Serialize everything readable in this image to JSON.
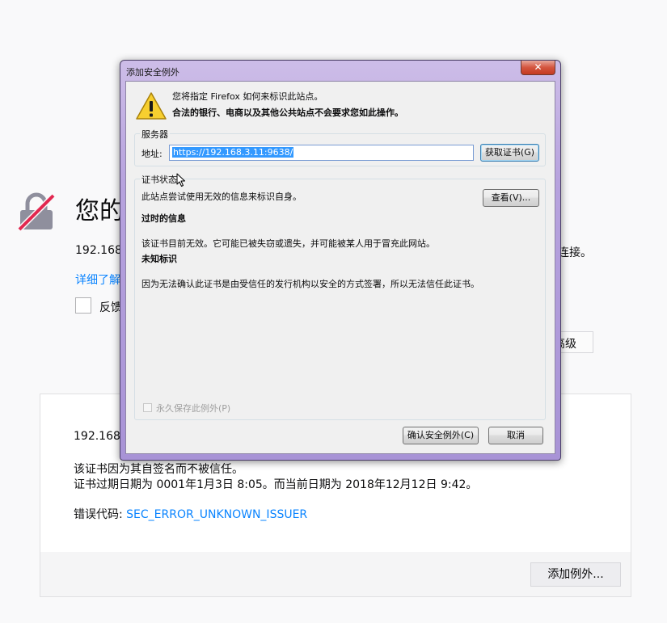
{
  "error_page": {
    "title": "您的",
    "description": "192.168.",
    "description_tail": "连接。",
    "learn_more": "详细了解",
    "report_label": "反馈",
    "advanced_button": "高级",
    "advanced_panel": {
      "host": "192.168.",
      "line1": "该证书因为其自签名而不被信任。",
      "line2": "证书过期日期为 0001年1月3日 8:05。而当前日期为 2018年12月12日 9:42。",
      "error_code_label": "错误代码: ",
      "error_code": "SEC_ERROR_UNKNOWN_ISSUER",
      "add_exception_button": "添加例外..."
    },
    "lock_icon": "lock-broken-icon"
  },
  "dialog": {
    "title": "添加安全例外",
    "close_icon": "close-icon",
    "close_glyph": "✕",
    "warning_icon": "warning-triangle-icon",
    "warning_line1": "您将指定 Firefox 如何来标识此站点。",
    "warning_line2": "合法的银行、电商以及其他公共站点不会要求您如此操作。",
    "server_group": {
      "label": "服务器",
      "address_label": "地址:",
      "address_value": "https://192.168.3.11:9638/",
      "get_cert_button": "获取证书(G)"
    },
    "cert_group": {
      "label": "证书状态",
      "status_text": "此站点尝试使用无效的信息来标识自身。",
      "view_button": "查看(V)...",
      "expired_heading": "过时的信息",
      "expired_text": "该证书目前无效。它可能已被失窃或遗失，并可能被某人用于冒充此网站。",
      "unknown_heading": "未知标识",
      "unknown_text": "因为无法确认此证书是由受信任的发行机构以安全的方式签署，所以无法信任此证书。",
      "permanent_label": "永久保存此例外(P)",
      "permanent_checked": false
    },
    "confirm_button": "确认安全例外(C)",
    "cancel_button": "取消"
  },
  "colors": {
    "link": "#0a84ff",
    "lock_red": "#e22850",
    "dialog_frame": "#b7a3de"
  }
}
